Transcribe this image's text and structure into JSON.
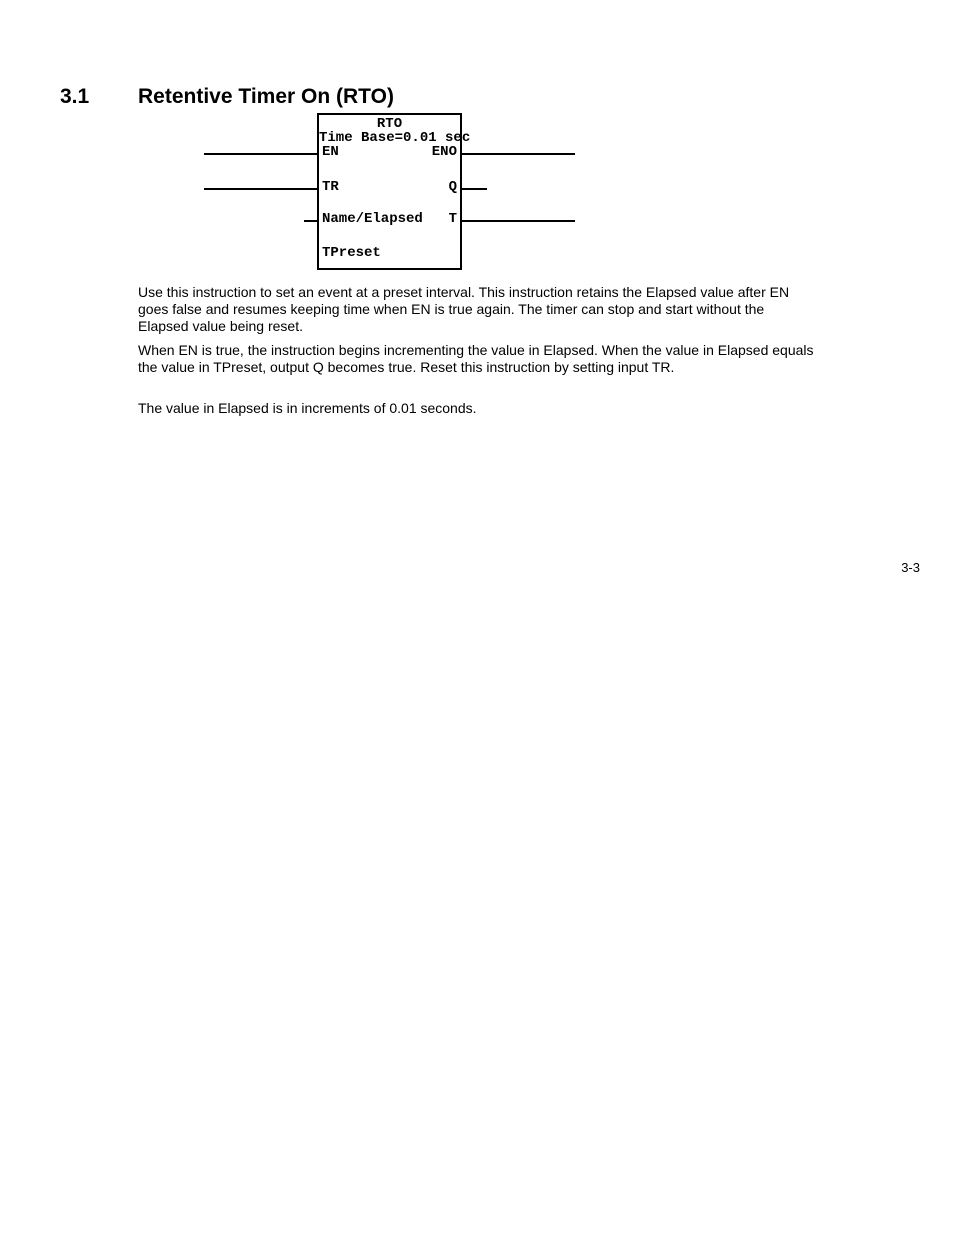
{
  "heading": {
    "number": "3.1",
    "title": "Retentive Timer On (RTO)"
  },
  "block": {
    "title": "RTO",
    "timebase": "Time Base=0.01 sec",
    "left": {
      "en": "EN",
      "tr": "TR",
      "name_elapsed": "Name/Elapsed",
      "tpreset": "TPreset"
    },
    "right": {
      "eno": "ENO",
      "q": "Q",
      "t": "T"
    }
  },
  "paragraphs": {
    "p1": "Use this instruction to set an event at a preset interval. This instruction retains the Elapsed value after EN goes false and resumes keeping time when EN is true again. The timer can stop and start without the Elapsed value being reset.",
    "p2": "When EN is true, the instruction begins incrementing the value in Elapsed. When the value in Elapsed equals the value in TPreset, output Q becomes true. Reset this instruction by setting input TR.",
    "p3": "The value in Elapsed is in increments of 0.01 seconds."
  },
  "page_number": "3-3"
}
